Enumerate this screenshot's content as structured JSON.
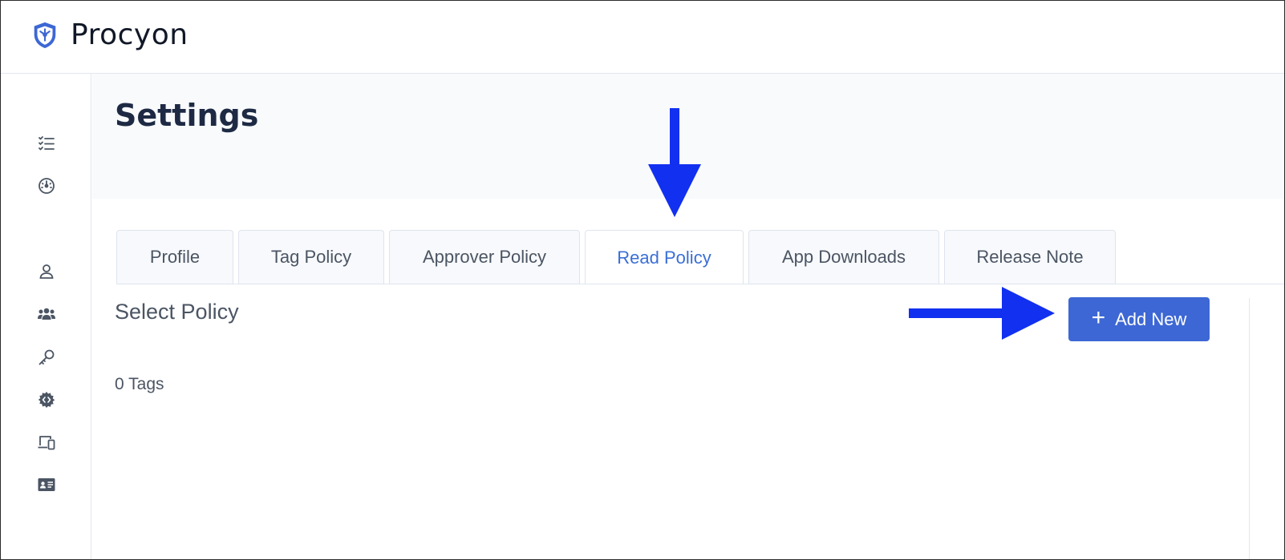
{
  "app": {
    "brand": "Procyon",
    "logo_icon": "procyon-shield-logo",
    "accent_color": "#3d67d4",
    "active_tab_color": "#3b6fd6"
  },
  "sidebar": {
    "items": [
      {
        "icon": "task-list-icon"
      },
      {
        "icon": "dashboard-gauge-icon"
      },
      {
        "icon": "user-icon"
      },
      {
        "icon": "users-group-icon"
      },
      {
        "icon": "key-icon"
      },
      {
        "icon": "gear-code-icon"
      },
      {
        "icon": "devices-icon"
      },
      {
        "icon": "id-card-icon"
      }
    ]
  },
  "page": {
    "title": "Settings"
  },
  "tabs": [
    {
      "label": "Profile",
      "active": false
    },
    {
      "label": "Tag Policy",
      "active": false
    },
    {
      "label": "Approver Policy",
      "active": false
    },
    {
      "label": "Read Policy",
      "active": true
    },
    {
      "label": "App Downloads",
      "active": false
    },
    {
      "label": "Release Note",
      "active": false
    }
  ],
  "content": {
    "section_title": "Select Policy",
    "tag_count": "0 Tags",
    "add_button_label": "Add New",
    "add_button_icon": "plus-icon"
  },
  "annotations": {
    "arrow_color": "#1230f0"
  }
}
